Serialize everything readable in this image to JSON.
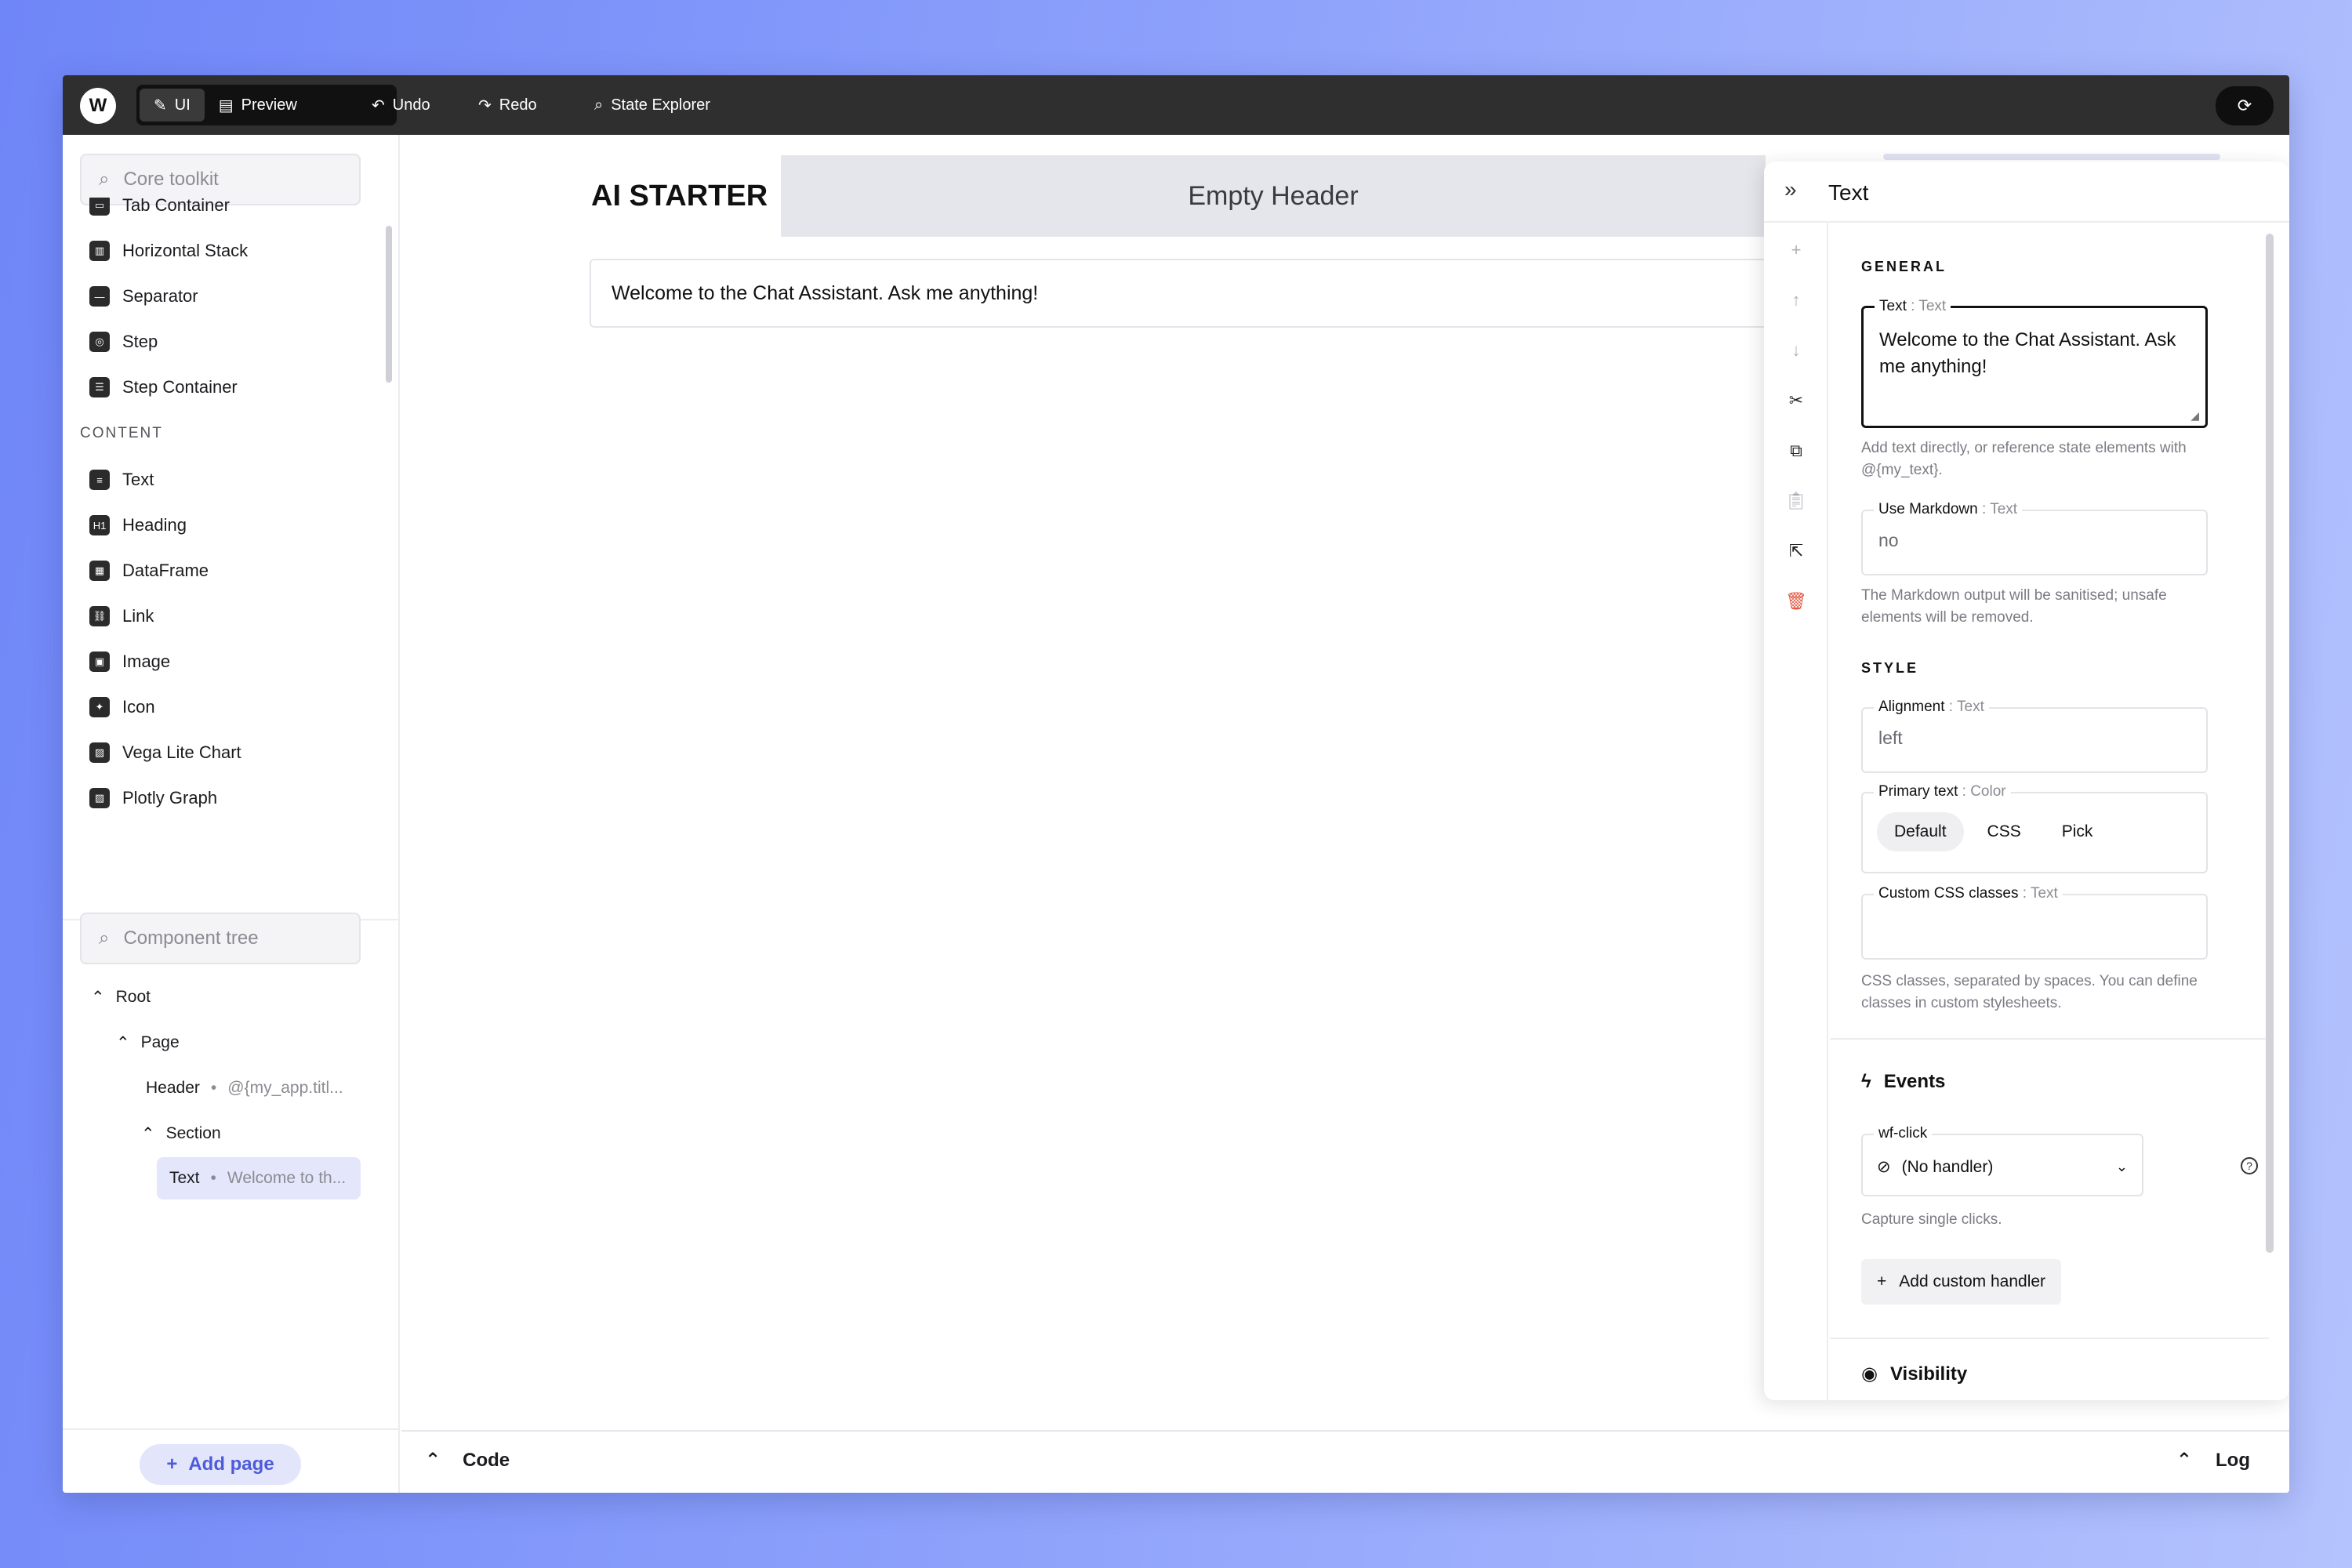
{
  "topbar": {
    "logo": "W",
    "mode_ui": "UI",
    "mode_preview": "Preview",
    "undo": "Undo",
    "redo": "Redo",
    "state_explorer": "State Explorer"
  },
  "sidebar": {
    "toolkit_search_placeholder": "Core toolkit",
    "layout_items": [
      {
        "label": "Tab Container",
        "icon": "tab-icon"
      },
      {
        "label": "Horizontal Stack",
        "icon": "columns-icon"
      },
      {
        "label": "Separator",
        "icon": "separator-icon"
      },
      {
        "label": "Step",
        "icon": "step-icon"
      },
      {
        "label": "Step Container",
        "icon": "list-icon"
      }
    ],
    "content_title": "CONTENT",
    "content_items": [
      {
        "label": "Text",
        "icon": "text-icon"
      },
      {
        "label": "Heading",
        "icon": "heading-icon"
      },
      {
        "label": "DataFrame",
        "icon": "table-icon"
      },
      {
        "label": "Link",
        "icon": "link-icon"
      },
      {
        "label": "Image",
        "icon": "image-icon"
      },
      {
        "label": "Icon",
        "icon": "icon-icon"
      },
      {
        "label": "Vega Lite Chart",
        "icon": "chart-icon"
      },
      {
        "label": "Plotly Graph",
        "icon": "graph-icon"
      }
    ],
    "tree_search_placeholder": "Component tree",
    "tree": {
      "root": "Root",
      "page": "Page",
      "header": "Header",
      "header_meta": "@{my_app.titl...",
      "section": "Section",
      "text": "Text",
      "text_meta": "Welcome to th..."
    },
    "add_page": "Add page"
  },
  "canvas": {
    "app_title": "AI STARTER",
    "empty_header": "Empty Header",
    "welcome_text": "Welcome to the Chat Assistant. Ask me anything!"
  },
  "bottombar": {
    "code": "Code",
    "log": "Log"
  },
  "panel": {
    "title": "Text",
    "general_title": "GENERAL",
    "text_field": {
      "label": "Text",
      "type": ": Text",
      "value": "Welcome to the Chat Assistant. Ask me anything!"
    },
    "text_hint": "Add text directly, or reference state elements with @{my_text}.",
    "markdown_field": {
      "label": "Use Markdown",
      "type": ": Text",
      "value": "no"
    },
    "markdown_hint": "The Markdown output will be sanitised; unsafe elements will be removed.",
    "style_title": "STYLE",
    "alignment_field": {
      "label": "Alignment",
      "type": ": Text",
      "value": "left"
    },
    "primary_text_field": {
      "label": "Primary text",
      "type": ": Color",
      "options": [
        "Default",
        "CSS",
        "Pick"
      ]
    },
    "css_field": {
      "label": "Custom CSS classes",
      "type": ": Text",
      "value": ""
    },
    "css_hint": "CSS classes, separated by spaces. You can define classes in custom stylesheets.",
    "events_title": "Events",
    "wf_click_label": "wf-click",
    "wf_click_value": "(No handler)",
    "wf_click_hint": "Capture single clicks.",
    "add_handler": "Add custom handler",
    "visibility_title": "Visibility"
  },
  "colors": {
    "accent": "#4d5bd8",
    "topbar_bg": "#2f2f2f",
    "delete_red": "#e5533d",
    "selected_bg": "#e4e7fb"
  }
}
